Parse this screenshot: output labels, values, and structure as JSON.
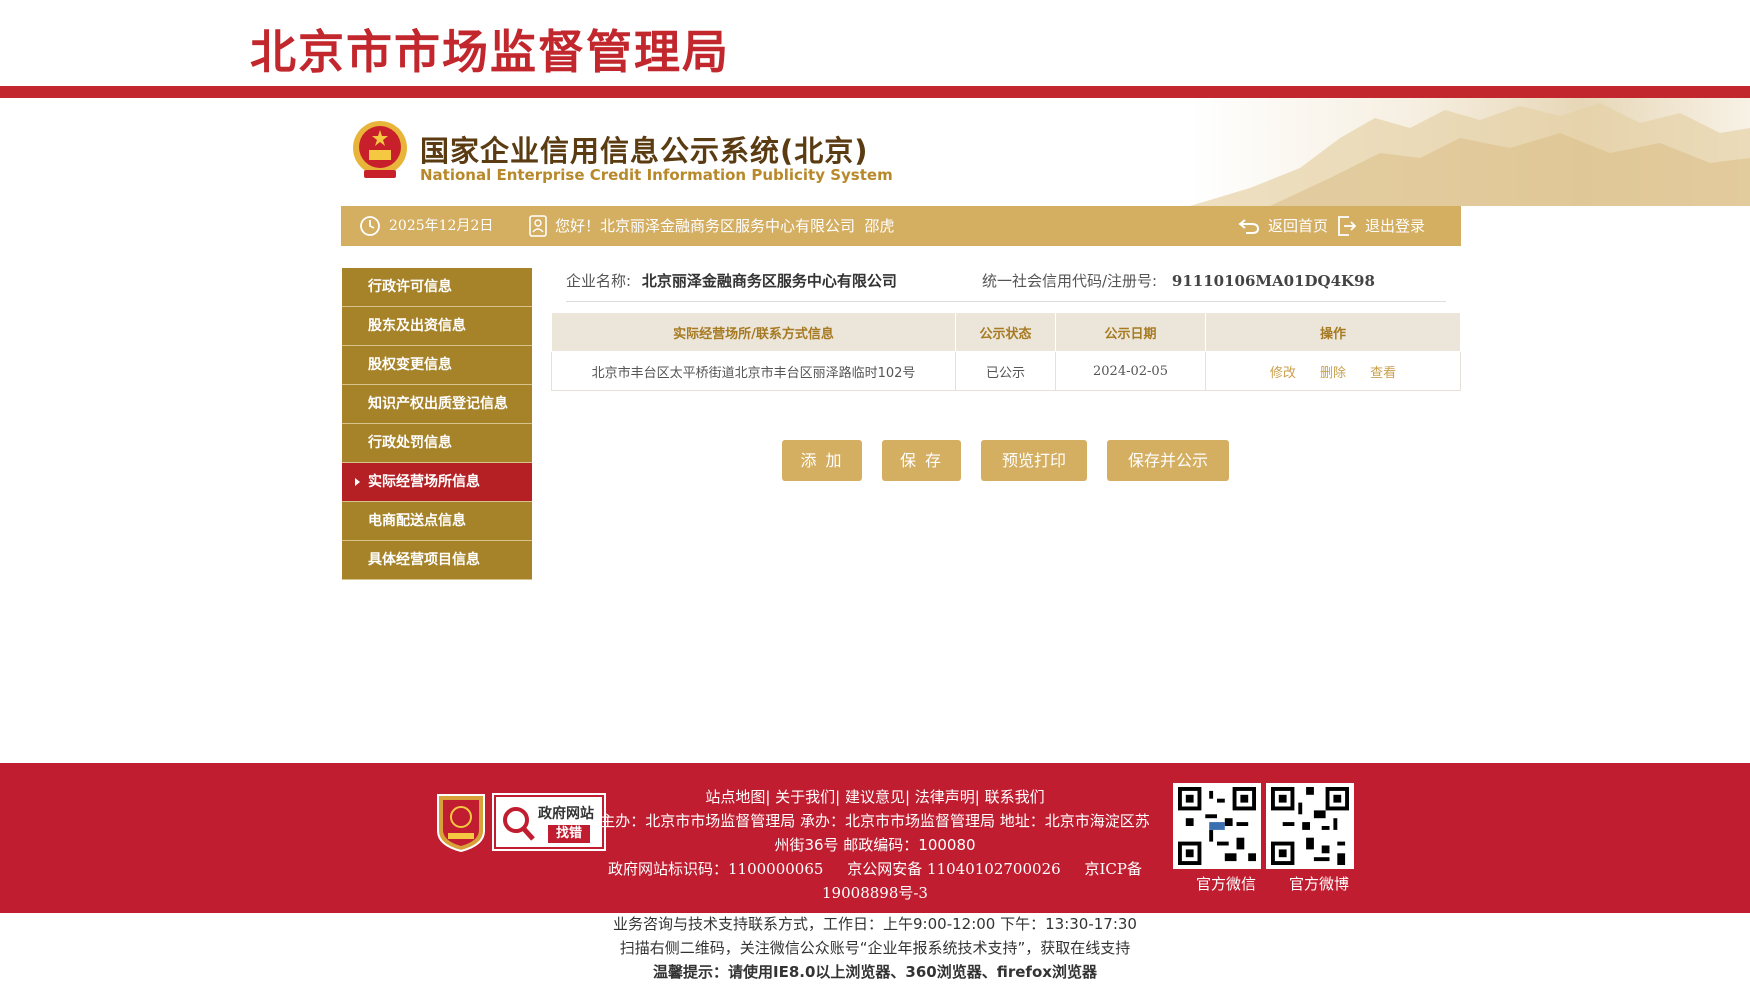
{
  "brand": {
    "title": "北京市市场监督管理局"
  },
  "system": {
    "title_cn": "国家企业信用信息公示系统(北京)",
    "title_en": "National Enterprise Credit Information Publicity System"
  },
  "statusbar": {
    "date": "2025年12月2日",
    "greeting": "您好！北京丽泽金融商务区服务中心有限公司  邵虎",
    "home_label": "返回首页",
    "logout_label": "退出登录"
  },
  "sidebar": {
    "items": [
      {
        "label": "行政许可信息"
      },
      {
        "label": "股东及出资信息"
      },
      {
        "label": "股权变更信息"
      },
      {
        "label": "知识产权出质登记信息"
      },
      {
        "label": "行政处罚信息"
      },
      {
        "label": "实际经营场所信息",
        "active": true
      },
      {
        "label": "电商配送点信息"
      },
      {
        "label": "具体经营项目信息"
      }
    ]
  },
  "company": {
    "name_label": "企业名称:",
    "name": "北京丽泽金融商务区服务中心有限公司",
    "code_label": "统一社会信用代码/注册号:",
    "code": "91110106MA01DQ4K98"
  },
  "table": {
    "headers": [
      "实际经营场所/联系方式信息",
      "公示状态",
      "公示日期",
      "操作"
    ],
    "rows": [
      {
        "address": "北京市丰台区太平桥街道北京市丰台区丽泽路临时102号",
        "status": "已公示",
        "date": "2024-02-05",
        "ops": [
          "修改",
          "删除",
          "查看"
        ]
      }
    ]
  },
  "buttons": {
    "add": "添 加",
    "save": "保 存",
    "preview": "预览打印",
    "save_publish": "保存并公示"
  },
  "footer": {
    "gov_line1": "政府网站",
    "gov_line2": "找错",
    "links": "站点地图| 关于我们| 建议意见| 法律声明| 联系我们",
    "host_line": "主办：北京市市场监督管理局 承办：北京市市场监督管理局 地址：北京市海淀区苏州街36号 邮政编码：100080",
    "id_line": "政府网站标识码：1100000065     京公网安备 11040102700026     京ICP备19008898号-3",
    "support_line": "业务咨询与技术支持联系方式，工作日：上午9:00-12:00 下午：13:30-17:30",
    "scan_line": "扫描右侧二维码，关注微信公众账号“企业年报系统技术支持”，获取在线支持",
    "tip_line": "温馨提示：请使用IE8.0以上浏览器、360浏览器、firefox浏览器",
    "qr_wechat": "官方微信",
    "qr_weibo": "官方微博"
  },
  "colors": {
    "brand_red": "#c1272d",
    "gold": "#d4ae61",
    "sidebar_gold": "#a68228",
    "active_red": "#b52025",
    "footer_red": "#c01d30"
  }
}
